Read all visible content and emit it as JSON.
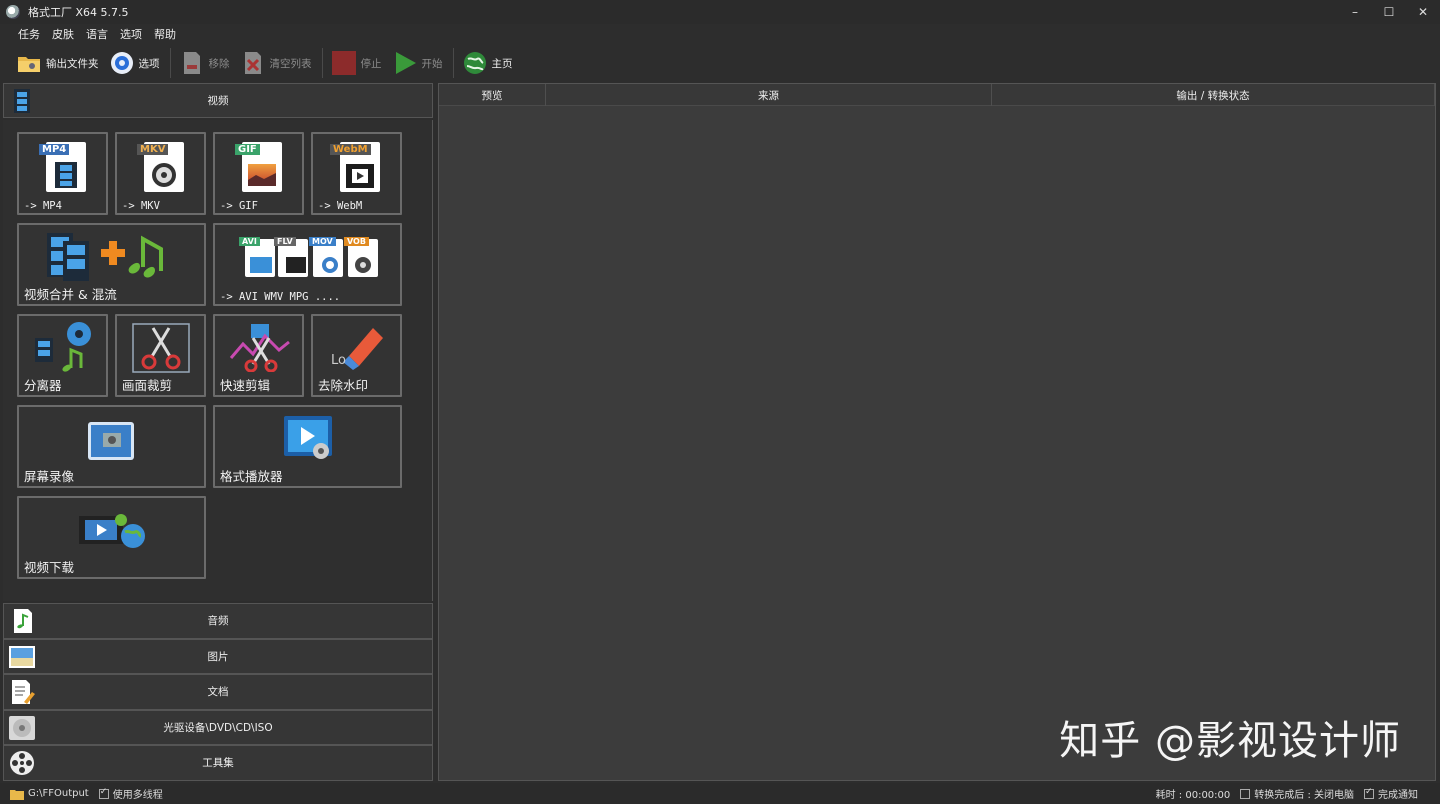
{
  "window": {
    "title": "格式工厂 X64 5.7.5",
    "controls": [
      "–",
      "☐",
      "✕"
    ]
  },
  "menu": [
    "任务",
    "皮肤",
    "语言",
    "选项",
    "帮助"
  ],
  "toolbar": {
    "output_folder": "输出文件夹",
    "options": "选项",
    "remove": "移除",
    "clear_list": "清空列表",
    "stop": "停止",
    "start": "开始",
    "home": "主页"
  },
  "sidebar": {
    "video_header": "视频",
    "tiles": {
      "mp4": {
        "badge": "MP4",
        "label": "-> MP4"
      },
      "mkv": {
        "badge": "MKV",
        "label": "-> MKV"
      },
      "gif": {
        "badge": "GIF",
        "label": "-> GIF"
      },
      "webm": {
        "badge": "WebM",
        "label": "-> WebM"
      },
      "merge": {
        "label": "视频合并 & 混流"
      },
      "others": {
        "label": "-> AVI WMV MPG ....",
        "badges": [
          "AVI",
          "FLV",
          "MOV",
          "VOB"
        ]
      },
      "splitter": {
        "label": "分离器"
      },
      "crop": {
        "label": "画面裁剪"
      },
      "quick_cut": {
        "label": "快速剪辑"
      },
      "remove_watermark": {
        "label": "去除水印"
      },
      "screen_record": {
        "label": "屏幕录像"
      },
      "player": {
        "label": "格式播放器"
      },
      "download": {
        "label": "视频下载"
      }
    },
    "categories": [
      "音频",
      "图片",
      "文档",
      "光驱设备\\DVD\\CD\\ISO",
      "工具集"
    ]
  },
  "task_list": {
    "columns": [
      "预览",
      "来源",
      "输出 / 转换状态"
    ]
  },
  "watermark": "知乎 @影视设计师",
  "status": {
    "output_path": "G:\\FFOutput",
    "multithread": "使用多线程",
    "elapsed": "耗时 : 00:00:00",
    "after_done": "转换完成后 : 关闭电脑",
    "notify": "完成通知"
  },
  "colors": {
    "background": "#2d2d2d",
    "panel": "#3c3c3c",
    "tile_border": "#6b6b6b"
  }
}
